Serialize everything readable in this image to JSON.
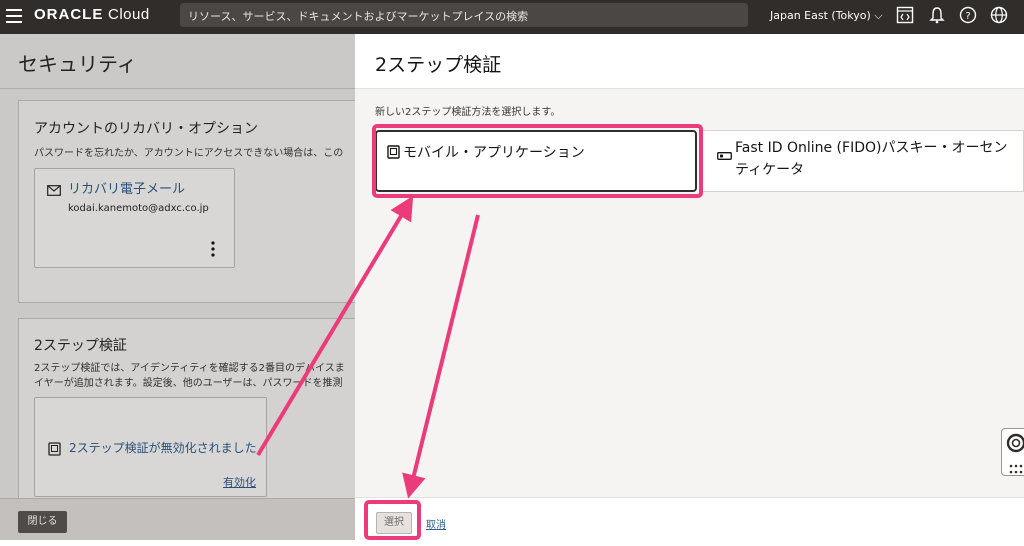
{
  "topbar": {
    "brand": "ORACLE",
    "product": "Cloud",
    "search_placeholder": "リソース、サービス、ドキュメントおよびマーケットプレイスの検索",
    "region": "Japan East (Tokyo)",
    "icons": [
      "hamburger-icon",
      "code-editor-icon",
      "bell-icon",
      "help-icon",
      "globe-icon"
    ]
  },
  "background": {
    "title": "セキュリティ",
    "recovery": {
      "title": "アカウントのリカバリ・オプション",
      "desc": "パスワードを忘れたか、アカウントにアクセスできない場合は、この",
      "email_label": "リカバリ電子メール",
      "email_value": "kodai.kanemoto@adxc.co.jp",
      "menu_icon": "kebab-menu-icon"
    },
    "twostep": {
      "title": "2ステップ検証",
      "desc1": "2ステップ検証では、アイデンティティを確認する2番目のデバイスま",
      "desc2": "イヤーが追加されます。設定後、他のユーザーは、パスワードを推測",
      "status": "2ステップ検証が無効化されました",
      "enable_link": "有効化"
    },
    "close_button": "閉じる"
  },
  "panel": {
    "title": "2ステップ検証",
    "instruction": "新しい2ステップ検証方法を選択します。",
    "options": [
      {
        "label": "モバイル・アプリケーション",
        "icon": "mobile-app-icon",
        "selected": true
      },
      {
        "label": "Fast ID Online (FIDO)パスキー・オーセンティケータ",
        "icon": "security-key-icon",
        "selected": false
      }
    ],
    "select_button": "選択",
    "cancel_link": "取消"
  },
  "annotation_color": "#ec3b7b"
}
